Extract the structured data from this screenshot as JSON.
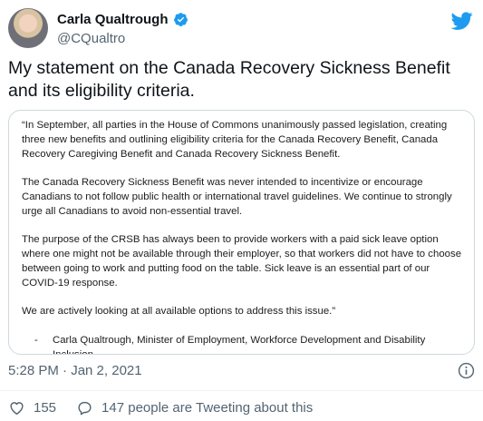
{
  "author": {
    "display_name": "Carla Qualtrough",
    "handle": "@CQualtro"
  },
  "tweet": {
    "text": "My statement on the Canada Recovery Sickness Benefit and its eligibility criteria.",
    "timestamp": "5:28 PM · Jan 2, 2021"
  },
  "statement": {
    "paragraphs": [
      "“In September, all parties in the House of Commons unanimously passed legislation, creating three new benefits and outlining eligibility criteria for the Canada Recovery Benefit, Canada Recovery Caregiving Benefit and Canada Recovery Sickness Benefit.",
      "The Canada Recovery Sickness Benefit was never intended to incentivize or encourage Canadians to not follow public health or international travel guidelines. We continue to strongly urge all Canadians to avoid non-essential travel.",
      "The purpose of the CRSB has always been to provide workers with a paid sick leave option where one might not be available through their employer, so that workers did not have to choose between going to work and putting food on the table. Sick leave is an essential part of our COVID-19 response.",
      "We are actively looking at all available options to address this issue.”"
    ],
    "signature_dash": "-",
    "signature": "Carla Qualtrough, Minister of Employment, Workforce Development and Disability Inclusion"
  },
  "actions": {
    "like_count": "155",
    "reply_text": "147 people are Tweeting about this"
  },
  "icons": {
    "verified": "verified-badge-icon",
    "brand": "twitter-bird-icon",
    "info": "info-icon",
    "like": "heart-icon",
    "reply": "speech-bubble-icon"
  },
  "colors": {
    "brand_blue": "#1d9bf0",
    "secondary_text": "#536471",
    "border": "#cfd9de"
  }
}
